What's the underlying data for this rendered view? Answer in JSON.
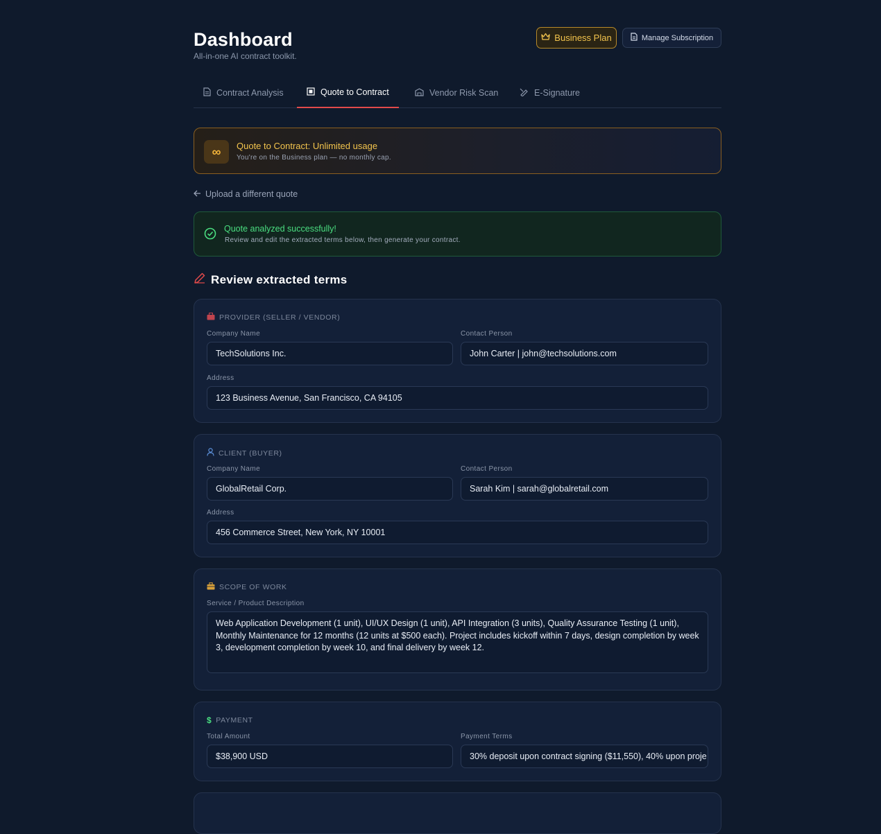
{
  "header": {
    "title": "Dashboard",
    "subtitle": "All-in-one AI contract toolkit.",
    "plan_label": "Business Plan",
    "manage_label": "Manage Subscription"
  },
  "tabs": [
    {
      "label": "Contract Analysis",
      "icon": "document-icon",
      "active": false
    },
    {
      "label": "Quote to Contract",
      "icon": "quote-icon",
      "active": true
    },
    {
      "label": "Vendor Risk Scan",
      "icon": "scan-icon",
      "active": false
    },
    {
      "label": "E-Signature",
      "icon": "signature-icon",
      "active": false
    }
  ],
  "usage": {
    "icon": "infinity-icon",
    "heading": "Quote to Contract: Unlimited usage",
    "subtext": "You're on the Business plan — no monthly cap."
  },
  "back_link": "Upload a different quote",
  "success": {
    "heading": "Quote analyzed successfully!",
    "subtext": "Review and edit the extracted terms below, then generate your contract."
  },
  "section_heading": "Review extracted terms",
  "provider": {
    "title": "PROVIDER (SELLER / VENDOR)",
    "company_label": "Company Name",
    "company_value": "TechSolutions Inc.",
    "contact_label": "Contact Person",
    "contact_value": "John Carter | john@techsolutions.com",
    "address_label": "Address",
    "address_value": "123 Business Avenue, San Francisco, CA 94105"
  },
  "client": {
    "title": "CLIENT (BUYER)",
    "company_label": "Company Name",
    "company_value": "GlobalRetail Corp.",
    "contact_label": "Contact Person",
    "contact_value": "Sarah Kim | sarah@globalretail.com",
    "address_label": "Address",
    "address_value": "456 Commerce Street, New York, NY 10001"
  },
  "scope": {
    "title": "SCOPE OF WORK",
    "desc_label": "Service / Product Description",
    "desc_value": "Web Application Development (1 unit), UI/UX Design (1 unit), API Integration (3 units), Quality Assurance Testing (1 unit), Monthly Maintenance for 12 months (12 units at $500 each). Project includes kickoff within 7 days, design completion by week 3, development completion by week 10, and final delivery by week 12."
  },
  "payment": {
    "title": "PAYMENT",
    "amount_label": "Total Amount",
    "amount_value": "$38,900 USD",
    "terms_label": "Payment Terms",
    "terms_value": "30% deposit upon contract signing ($11,550), 40% upon proje"
  },
  "colors": {
    "background": "#0f1a2c",
    "accent_red": "#e24a4a",
    "gold": "#f3c44d",
    "success_green": "#4ade80"
  }
}
